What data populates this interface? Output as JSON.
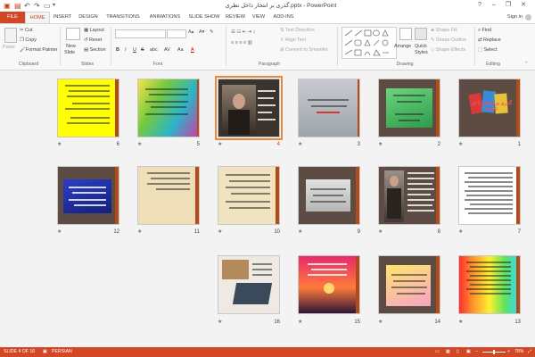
{
  "window": {
    "title": "گذری بر انتخار ذاخل نظری.pptx - PowerPoint",
    "help": "?",
    "minimize": "–",
    "restore": "❐",
    "close": "✕"
  },
  "quick_access": {
    "save_icon": "save-icon",
    "undo_icon": "undo-icon",
    "redo_icon": "redo-icon",
    "present_icon": "start-from-beginning-icon"
  },
  "tabs": [
    "FILE",
    "HOME",
    "INSERT",
    "DESIGN",
    "TRANSITIONS",
    "ANIMATIONS",
    "SLIDE SHOW",
    "REVIEW",
    "VIEW",
    "ADD-INS"
  ],
  "active_tab": "HOME",
  "user": {
    "sign_in": "Sign in"
  },
  "ribbon": {
    "clipboard": {
      "paste": "Paste",
      "cut": "Cut",
      "copy": "Copy",
      "format_painter": "Format Painter",
      "group": "Clipboard"
    },
    "slides": {
      "new_slide": "New",
      "new_slide_2": "Slide",
      "layout": "Layout",
      "reset": "Reset",
      "section": "Section",
      "group": "Slides"
    },
    "font": {
      "group": "Font",
      "bold": "B",
      "italic": "I",
      "underline": "U",
      "strike": "S",
      "shadow": "abc",
      "spacing": "AV",
      "case": "Aa",
      "color": "A"
    },
    "paragraph": {
      "text_direction": "Text Direction",
      "align_text": "Align Text",
      "smartart": "Convert to SmartArt",
      "group": "Paragraph"
    },
    "drawing": {
      "arrange": "Arrange",
      "quick_styles": "Quick",
      "quick_styles_2": "Styles",
      "shape_fill": "Shape Fill",
      "shape_outline": "Shape Outline",
      "shape_effects": "Shape Effects",
      "group": "Drawing"
    },
    "editing": {
      "find": "Find",
      "replace": "Replace",
      "select": "Select",
      "group": "Editing"
    }
  },
  "slides": [
    {
      "number": "1",
      "star": "★",
      "title": "گذری بر انتحار ذاخل نظری"
    },
    {
      "number": "2",
      "star": "★"
    },
    {
      "number": "3",
      "star": "★"
    },
    {
      "number": "4",
      "star": "★"
    },
    {
      "number": "5",
      "star": "★"
    },
    {
      "number": "6",
      "star": "★"
    },
    {
      "number": "7",
      "star": "★"
    },
    {
      "number": "8",
      "star": "★"
    },
    {
      "number": "9",
      "star": "★"
    },
    {
      "number": "10",
      "star": "★"
    },
    {
      "number": "11",
      "star": "★"
    },
    {
      "number": "12",
      "star": "★"
    },
    {
      "number": "13",
      "star": "★"
    },
    {
      "number": "14",
      "star": "★"
    },
    {
      "number": "15",
      "star": "★"
    },
    {
      "number": "16",
      "star": "★"
    }
  ],
  "status": {
    "slide": "SLIDE 4 OF 16",
    "language": "PERSIAN",
    "zoom": "78%",
    "zoom_minus": "–",
    "zoom_plus": "+"
  },
  "colors": {
    "accent": "#d24726",
    "selection": "#e8883a",
    "status_bar": "#d24726"
  }
}
